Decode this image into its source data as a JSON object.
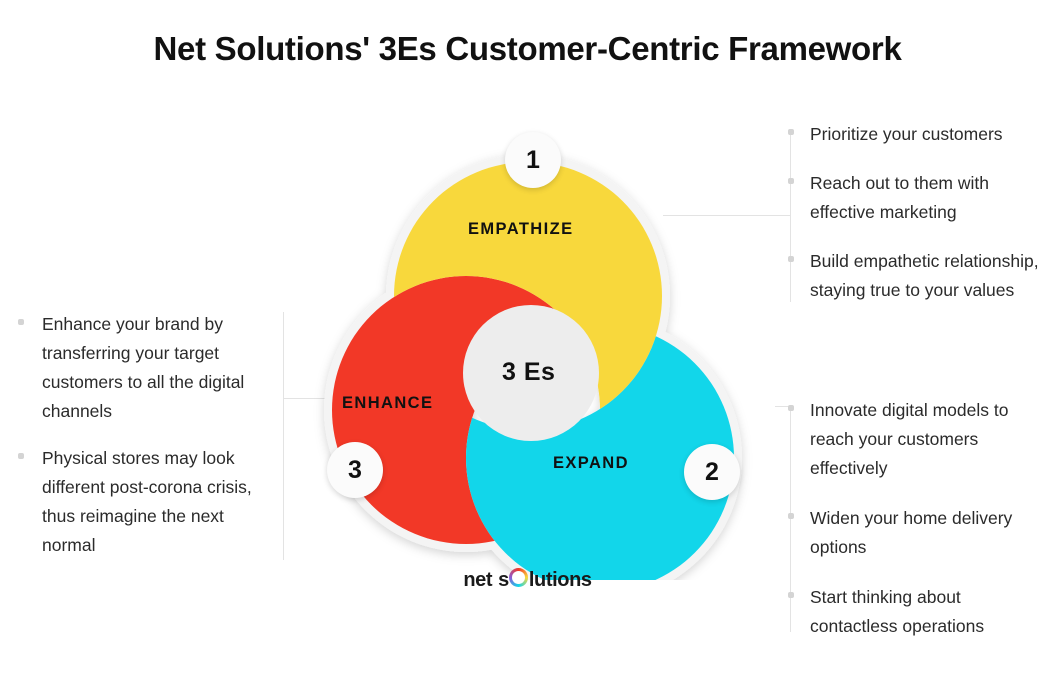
{
  "page": {
    "title": "Net Solutions' 3Es Customer-Centric Framework",
    "background": "#ffffff"
  },
  "diagram": {
    "center_label": "3 Es",
    "lobes": [
      {
        "id": "empathize",
        "label": "EMPATHIZE",
        "badge": "1",
        "color": "#f8d83c"
      },
      {
        "id": "expand",
        "label": "EXPAND",
        "badge": "2",
        "color": "#12d6ea"
      },
      {
        "id": "enhance",
        "label": "ENHANCE",
        "badge": "3",
        "color": "#f23827"
      }
    ],
    "center_color": "#ededed"
  },
  "bullets": {
    "empathize": [
      "Prioritize your customers",
      "Reach out to them with effective marketing",
      "Build empathetic relationship, staying true to your values"
    ],
    "expand": [
      "Innovate digital models to reach your customers effectively",
      "Widen your home delivery options",
      "Start thinking about contactless operations"
    ],
    "enhance": [
      "Enhance your brand by transferring your target customers to all the digital channels",
      "Physical stores may look different post-corona crisis, thus reimagine the next normal"
    ]
  },
  "logo": {
    "word1": "net",
    "word2_pre": "s",
    "word2_post": "lutions"
  },
  "chart_data": {
    "type": "diagram",
    "title": "Net Solutions' 3Es Customer-Centric Framework",
    "subtype": "three-overlapping-circles-pinwheel",
    "center": "3 Es",
    "segments": [
      {
        "step": 1,
        "name": "EMPATHIZE",
        "color": "#f8d83c",
        "position": "top",
        "points": [
          "Prioritize your customers",
          "Reach out to them with effective marketing",
          "Build empathetic relationship, staying true to your values"
        ]
      },
      {
        "step": 2,
        "name": "EXPAND",
        "color": "#12d6ea",
        "position": "bottom-right",
        "points": [
          "Innovate digital models to reach your customers effectively",
          "Widen your home delivery options",
          "Start thinking about contactless operations"
        ]
      },
      {
        "step": 3,
        "name": "ENHANCE",
        "color": "#f23827",
        "position": "left",
        "points": [
          "Enhance your brand by transferring your target customers to all the digital channels",
          "Physical stores may look different post-corona crisis, thus reimagine the next normal"
        ]
      }
    ]
  }
}
